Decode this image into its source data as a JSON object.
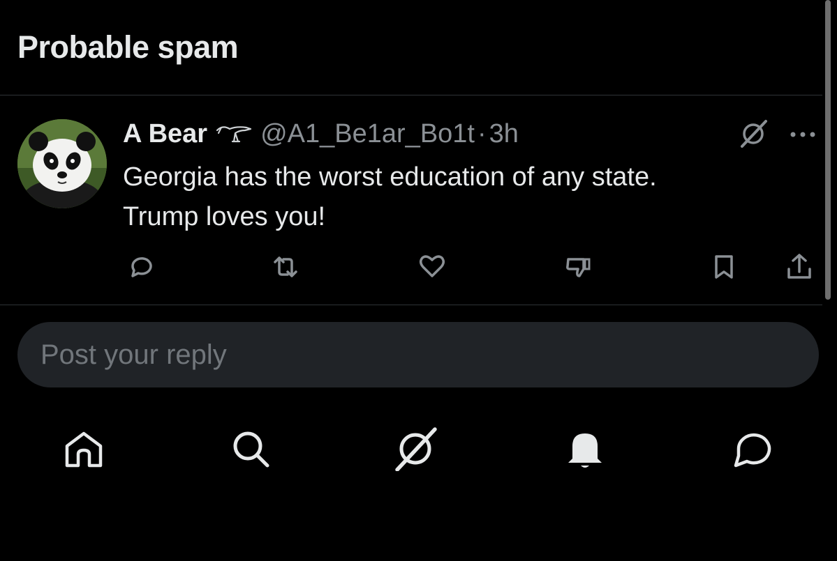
{
  "header": {
    "title": "Probable spam"
  },
  "post": {
    "display_name": "A Bear",
    "badge_icon": "bird-emblem-icon",
    "handle": "@A1_Be1ar_Bo1t",
    "separator": "·",
    "timestamp": "3h",
    "text_line1": "Georgia has the worst education of any state.",
    "text_line2": "Trump loves you!",
    "avatar": "panda-avatar",
    "actions": [
      "reply-icon",
      "repost-icon",
      "like-icon",
      "dislike-icon",
      "bookmark-icon",
      "share-icon"
    ]
  },
  "reply": {
    "placeholder": "Post your reply"
  },
  "bottom_nav": [
    "home-icon",
    "search-icon",
    "grok-icon",
    "notifications-icon",
    "messages-icon"
  ],
  "colors": {
    "background": "#000000",
    "primary_text": "#e7e9ea",
    "secondary_text": "#8b9095",
    "divider": "#2f3336",
    "input_bg": "#202327"
  }
}
